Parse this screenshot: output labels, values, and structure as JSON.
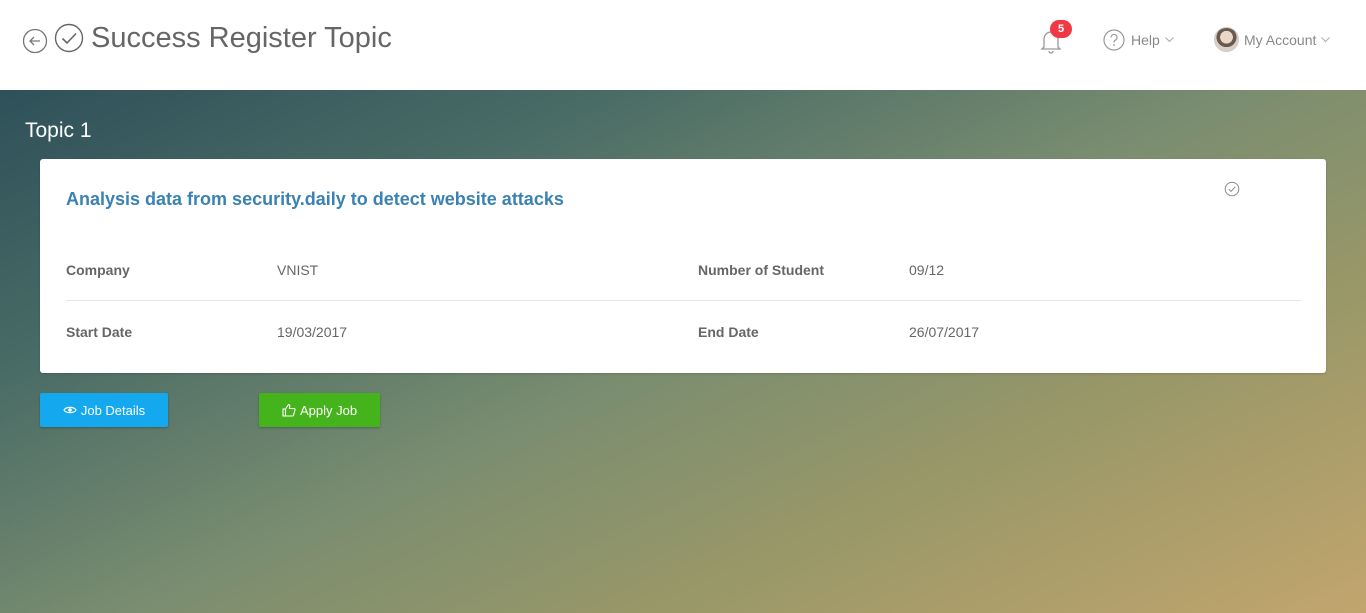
{
  "header": {
    "title": "Success Register Topic",
    "notifications_count": "5",
    "help_label": "Help",
    "account_label": "My Account"
  },
  "topic": {
    "heading": "Topic 1",
    "title": "Analysis data from security.daily to detect website attacks",
    "fields": {
      "company_label": "Company",
      "company_value": "VNIST",
      "students_label": "Number of Student",
      "students_value": "09/12",
      "start_label": "Start Date",
      "start_value": "19/03/2017",
      "end_label": "End Date",
      "end_value": "26/07/2017"
    }
  },
  "actions": {
    "details_label": "Job Details",
    "apply_label": "Apply Job"
  },
  "colors": {
    "title_blue": "#3a82b3",
    "details_button": "#14a8ef",
    "apply_button": "#45b41c",
    "badge_red": "#ef3a45"
  },
  "icons": [
    "back-arrow-icon",
    "check-circle-icon",
    "bell-icon",
    "help-circle-icon",
    "chevron-down-icon",
    "eye-icon",
    "thumbs-up-icon"
  ]
}
